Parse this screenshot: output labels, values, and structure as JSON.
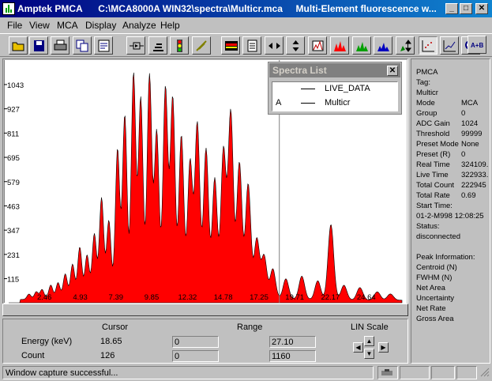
{
  "window": {
    "title": "Amptek PMCA      C:\\MCA8000A WIN32\\spectra\\Multicr.mca     Multi-Element fluorescence w...",
    "minimize": "_",
    "maximize": "□",
    "close": "✕"
  },
  "menu": [
    "File",
    "View",
    "MCA",
    "Display",
    "Analyze",
    "Help"
  ],
  "toolbar": [
    {
      "name": "open-icon",
      "color": "#c8a000"
    },
    {
      "name": "save-icon",
      "color": "#000080"
    },
    {
      "name": "print-icon",
      "color": "#404040"
    },
    {
      "name": "copy-icon",
      "color": "#000080"
    },
    {
      "name": "report-icon",
      "color": "#000080"
    },
    {
      "name": "connect-icon",
      "color": "#000000"
    },
    {
      "name": "acquire-icon",
      "color": "#000000"
    },
    {
      "name": "traffic-light-icon",
      "color": "#c00000"
    },
    {
      "name": "clear-icon",
      "color": "#808000"
    },
    {
      "name": "roi-icon",
      "color": "#c00000"
    },
    {
      "name": "document-icon",
      "color": "#000000"
    },
    {
      "name": "horizontal-arrows-icon",
      "color": "#000000"
    },
    {
      "name": "vertical-arrows-icon",
      "color": "#000000"
    },
    {
      "name": "zoom-box-icon",
      "color": "#c00000"
    },
    {
      "name": "peaks-red-icon",
      "color": "#c00000"
    },
    {
      "name": "peaks-green-icon",
      "color": "#008000"
    },
    {
      "name": "peaks-blue-icon",
      "color": "#000080"
    },
    {
      "name": "scale-arrows-icon",
      "color": "#000000"
    },
    {
      "name": "scatter-icon",
      "color": "#c00000"
    },
    {
      "name": "line-plot-icon",
      "color": "#000080"
    },
    {
      "name": "magnify-icon",
      "color": "#c00000"
    },
    {
      "name": "add-spectra-icon",
      "color": "#000080",
      "label": "A+B"
    }
  ],
  "plot": {
    "y_ticks": [
      "1043",
      "927",
      "811",
      "695",
      "579",
      "463",
      "347",
      "231",
      "115"
    ],
    "x_ticks": [
      "2.46",
      "4.93",
      "7.39",
      "9.85",
      "12.32",
      "14.78",
      "17.25",
      "19.71",
      "22.17",
      "24.64"
    ],
    "fill_color": "#ff0000"
  },
  "chart_data": {
    "type": "area",
    "x_unit": "keV",
    "xlim": [
      0,
      27.1
    ],
    "ylim": [
      0,
      1160
    ],
    "y_ticks": [
      115,
      231,
      347,
      463,
      579,
      695,
      811,
      927,
      1043
    ],
    "cursor_energy_keV": 18.65,
    "peaks": [
      {
        "e": 1.4,
        "h": 25
      },
      {
        "e": 1.9,
        "h": 35
      },
      {
        "e": 2.3,
        "h": 45
      },
      {
        "e": 2.9,
        "h": 65
      },
      {
        "e": 3.4,
        "h": 75
      },
      {
        "e": 3.9,
        "h": 115
      },
      {
        "e": 4.4,
        "h": 160
      },
      {
        "e": 4.9,
        "h": 240
      },
      {
        "e": 5.4,
        "h": 200
      },
      {
        "e": 5.9,
        "h": 300
      },
      {
        "e": 6.4,
        "h": 470
      },
      {
        "e": 6.9,
        "h": 360
      },
      {
        "e": 7.5,
        "h": 700
      },
      {
        "e": 8.0,
        "h": 860
      },
      {
        "e": 8.6,
        "h": 1060
      },
      {
        "e": 9.1,
        "h": 940
      },
      {
        "e": 9.7,
        "h": 1050
      },
      {
        "e": 10.2,
        "h": 780
      },
      {
        "e": 10.8,
        "h": 990
      },
      {
        "e": 11.3,
        "h": 940
      },
      {
        "e": 11.9,
        "h": 760
      },
      {
        "e": 12.5,
        "h": 640
      },
      {
        "e": 13.0,
        "h": 820
      },
      {
        "e": 13.6,
        "h": 700
      },
      {
        "e": 14.2,
        "h": 560
      },
      {
        "e": 14.8,
        "h": 700
      },
      {
        "e": 15.3,
        "h": 880
      },
      {
        "e": 15.9,
        "h": 640
      },
      {
        "e": 16.5,
        "h": 540
      },
      {
        "e": 17.1,
        "h": 280
      },
      {
        "e": 17.6,
        "h": 200
      },
      {
        "e": 18.2,
        "h": 140
      },
      {
        "e": 19.1,
        "h": 95
      },
      {
        "e": 20.2,
        "h": 110
      },
      {
        "e": 21.3,
        "h": 90
      },
      {
        "e": 22.2,
        "h": 360
      },
      {
        "e": 23.1,
        "h": 70
      },
      {
        "e": 24.2,
        "h": 60
      },
      {
        "e": 25.4,
        "h": 40
      },
      {
        "e": 26.3,
        "h": 30
      }
    ]
  },
  "spectra_list": {
    "title": "Spectra List",
    "close": "✕",
    "items": [
      {
        "tag": "",
        "name": "LIVE_DATA"
      },
      {
        "tag": "A",
        "name": "Multicr"
      }
    ]
  },
  "info": {
    "header": "PMCA",
    "tag_label": "Tag:",
    "tag_value": "Multicr",
    "rows": [
      {
        "label": "Mode",
        "value": "MCA"
      },
      {
        "label": "Group",
        "value": "0"
      },
      {
        "label": "ADC Gain",
        "value": "1024"
      },
      {
        "label": "Threshold",
        "value": "99999"
      },
      {
        "label": "Preset Mode",
        "value": "None"
      },
      {
        "label": "Preset (R)",
        "value": "0"
      },
      {
        "label": "Real Time",
        "value": "324109."
      },
      {
        "label": "Live Time",
        "value": "322933."
      },
      {
        "label": "Total Count",
        "value": "222945"
      },
      {
        "label": "Total Rate",
        "value": "0.69"
      }
    ],
    "start_label": "Start Time:",
    "start_value": "01-2-M998 12:08:25",
    "status_label": "Status:",
    "status_value": "disconnected",
    "peak_header": "Peak Information:",
    "peak_rows": [
      "Centroid (N)",
      "FWHM (N)",
      "Net Area",
      "Uncertainty",
      "Net Rate",
      "Gross Area"
    ]
  },
  "status_panel": {
    "cursor_header": "Cursor",
    "range_header": "Range",
    "scale_header": "LIN Scale",
    "energy_label": "Energy (keV)",
    "energy_value": "18.65",
    "energy_range_min": "0",
    "energy_range_max": "27.10",
    "count_label": "Count",
    "count_value": "126",
    "count_range_min": "0",
    "count_range_max": "1160"
  },
  "statusbar": {
    "text": "Window capture successful..."
  }
}
